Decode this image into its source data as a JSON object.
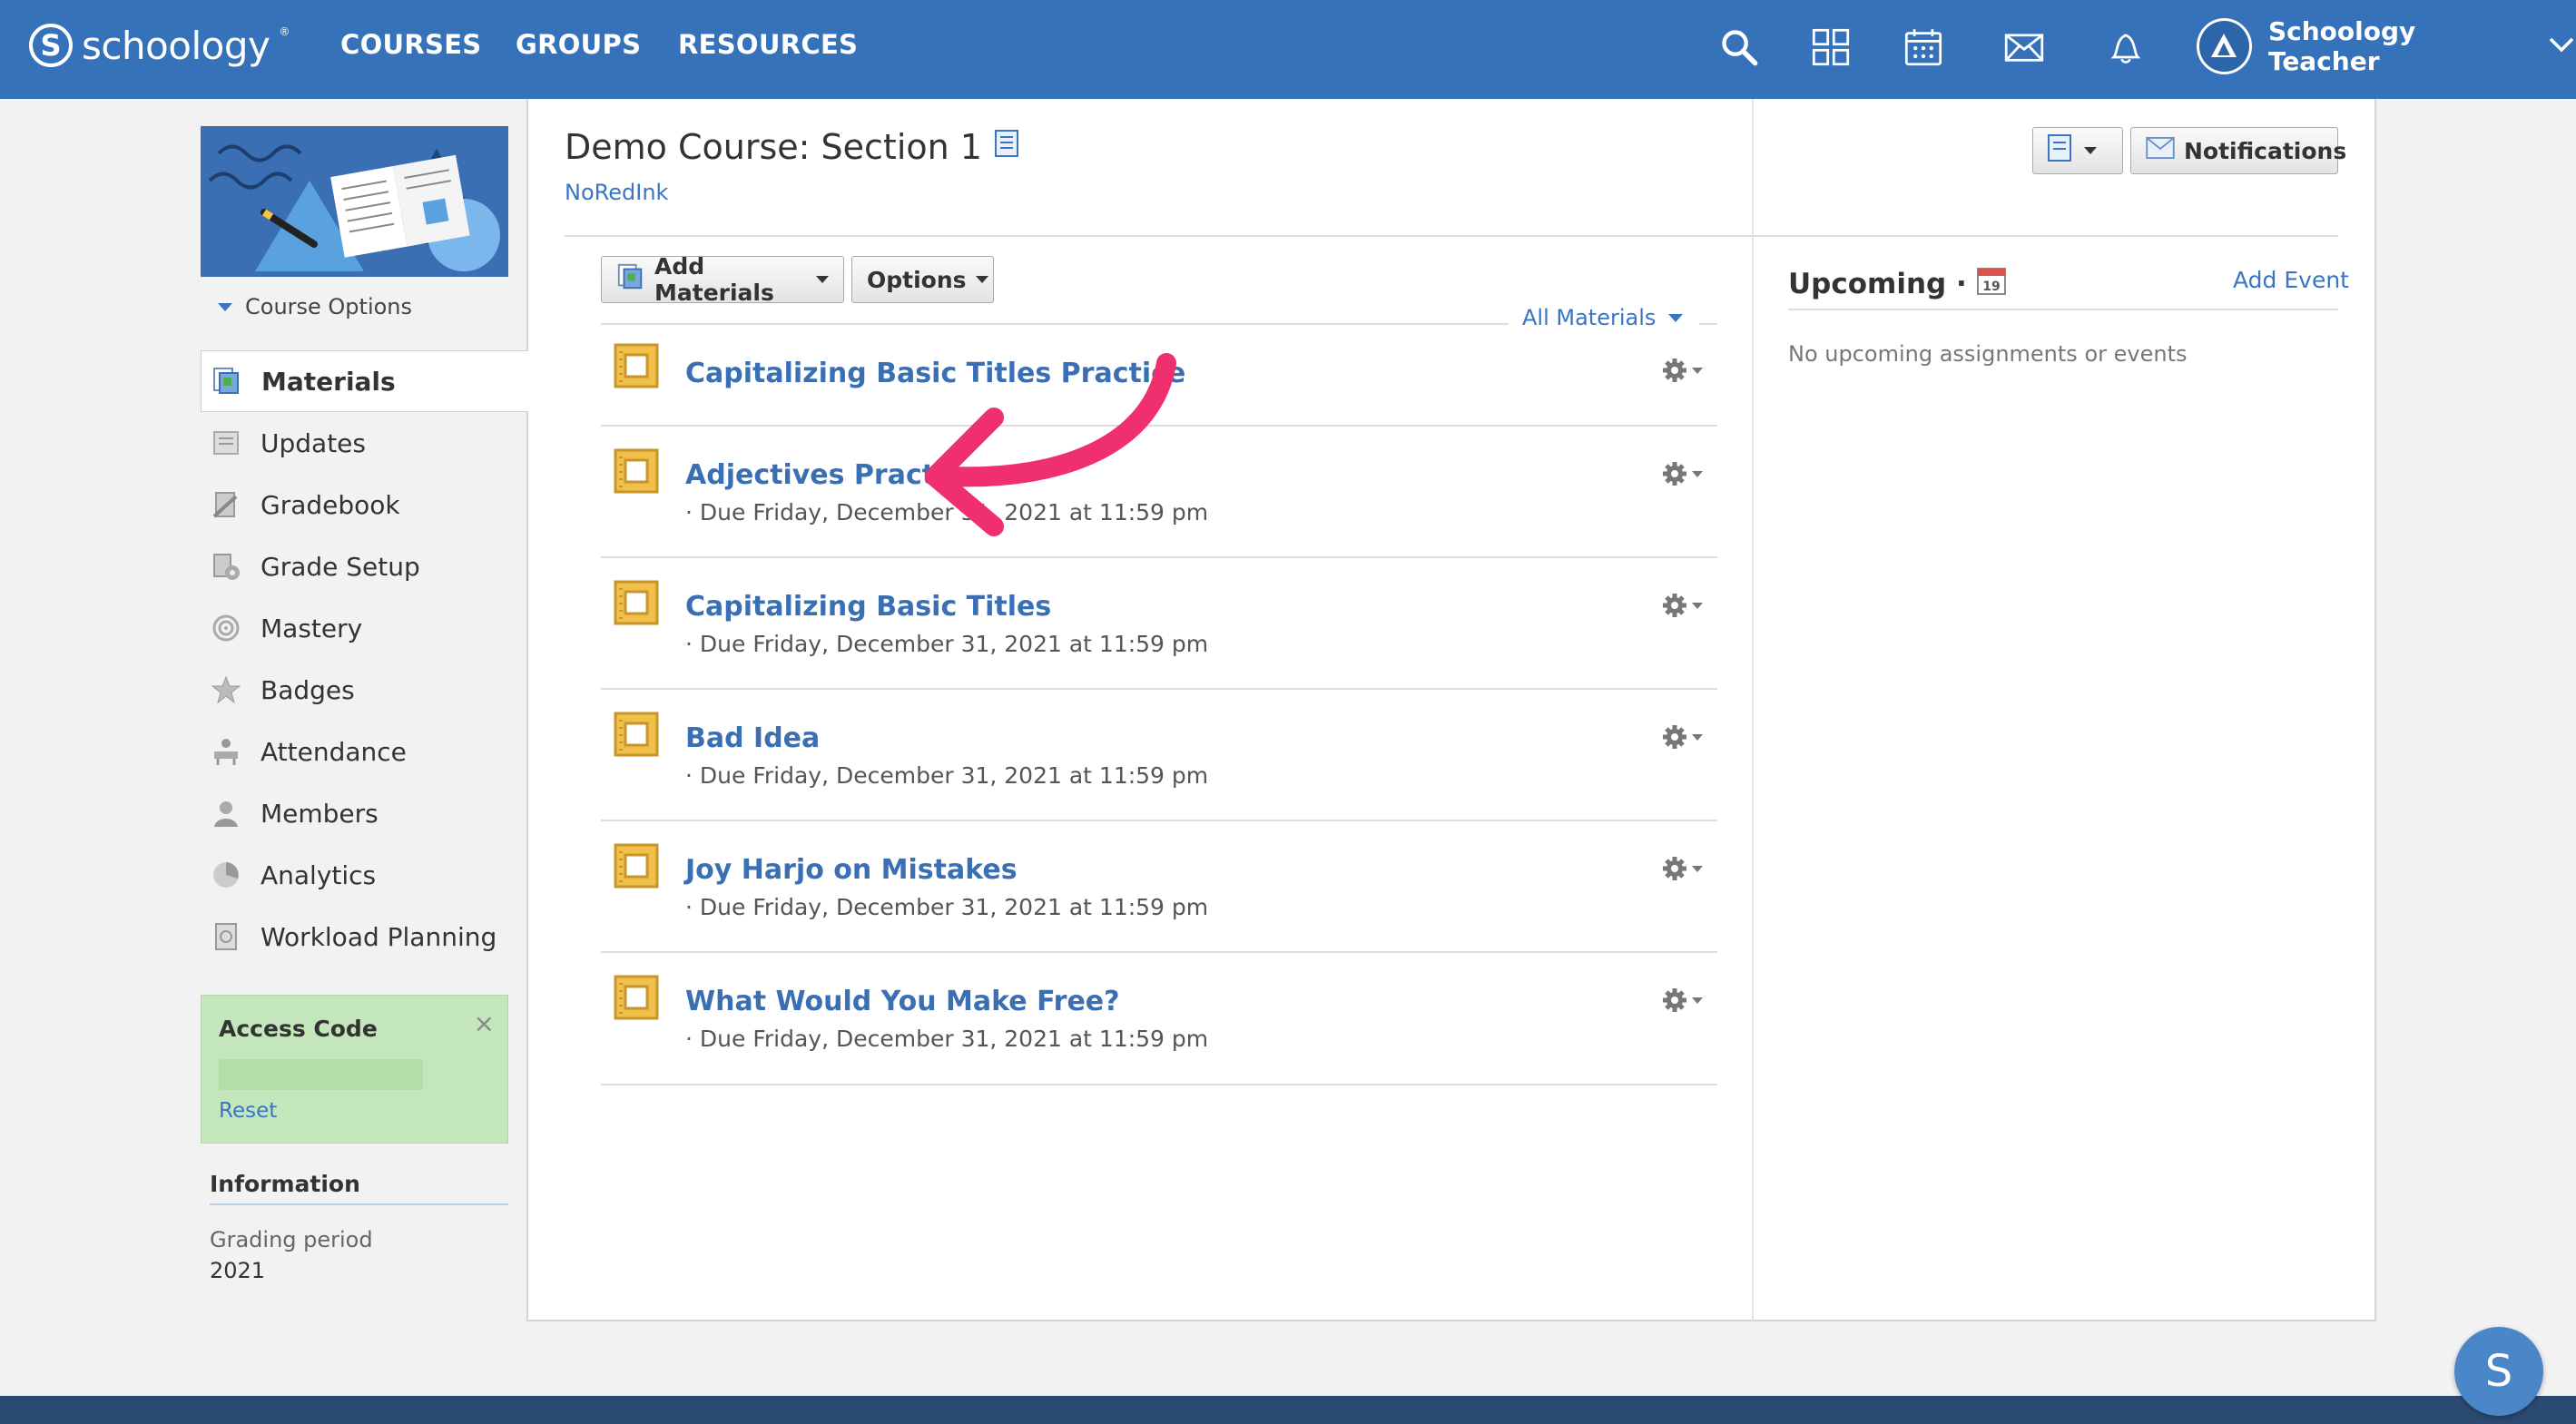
{
  "nav": {
    "logo_text": "schoology",
    "logo_mark": "S",
    "links": [
      "COURSES",
      "GROUPS",
      "RESOURCES"
    ],
    "icons": [
      "search-icon",
      "apps-grid-icon",
      "calendar-icon",
      "mail-icon",
      "notification-bell-icon"
    ],
    "user_name": "Schoology Teacher"
  },
  "sidebar": {
    "course_options": "Course Options",
    "items": [
      {
        "label": "Materials",
        "icon": "materials-icon"
      },
      {
        "label": "Updates",
        "icon": "updates-icon"
      },
      {
        "label": "Gradebook",
        "icon": "gradebook-icon"
      },
      {
        "label": "Grade Setup",
        "icon": "grade-setup-icon"
      },
      {
        "label": "Mastery",
        "icon": "mastery-icon"
      },
      {
        "label": "Badges",
        "icon": "badges-icon"
      },
      {
        "label": "Attendance",
        "icon": "attendance-icon"
      },
      {
        "label": "Members",
        "icon": "members-icon"
      },
      {
        "label": "Analytics",
        "icon": "analytics-icon"
      },
      {
        "label": "Workload Planning",
        "icon": "workload-planning-icon"
      }
    ],
    "access_code": {
      "title": "Access Code",
      "reset": "Reset",
      "close": "×"
    },
    "info": {
      "title": "Information",
      "label": "Grading period",
      "value": "2021"
    }
  },
  "course": {
    "title": "Demo Course: Section 1",
    "subtitle": "NoRedInk"
  },
  "toolbar": {
    "add_materials": "Add Materials",
    "options": "Options",
    "filter": "All Materials",
    "notifications": "Notifications"
  },
  "materials": [
    {
      "title": "Capitalizing Basic Titles Practice",
      "due": ""
    },
    {
      "title": "Adjectives Practice",
      "due": "· Due Friday, December 31, 2021 at 11:59 pm"
    },
    {
      "title": "Capitalizing Basic Titles",
      "due": "· Due Friday, December 31, 2021 at 11:59 pm"
    },
    {
      "title": "Bad Idea",
      "due": "· Due Friday, December 31, 2021 at 11:59 pm"
    },
    {
      "title": "Joy Harjo on Mistakes",
      "due": "· Due Friday, December 31, 2021 at 11:59 pm"
    },
    {
      "title": "What Would You Make Free?",
      "due": "· Due Friday, December 31, 2021 at 11:59 pm"
    }
  ],
  "upcoming": {
    "title": "Upcoming ·",
    "calendar_day": "19",
    "add_event": "Add Event",
    "empty": "No upcoming assignments or events"
  },
  "help_bubble": "S",
  "colors": {
    "nav": "#3672b9",
    "link": "#3a75c4",
    "access_bg": "#c4e6bc",
    "annotation_arrow": "#f0306e"
  }
}
